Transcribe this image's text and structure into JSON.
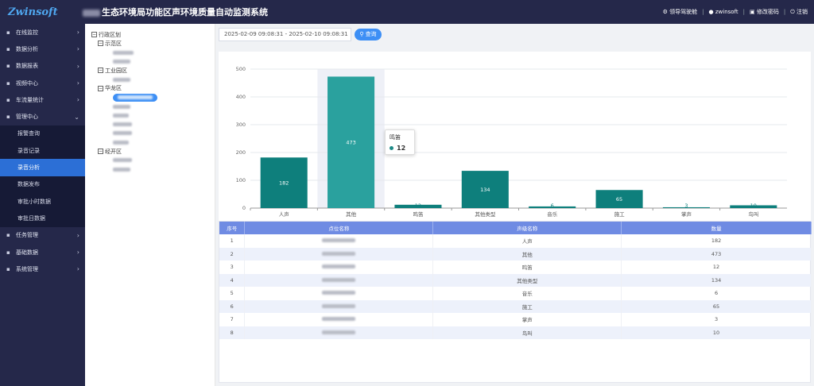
{
  "header": {
    "logo_text": "Zwinsoft",
    "title": "生态环境局功能区声环境质量自动监测系统",
    "right": {
      "nav_label": "领导驾驶舱",
      "user_label": "zwinsoft",
      "password_label": "修改密码",
      "logout_label": "注销"
    }
  },
  "sidebar": {
    "items": [
      {
        "label": "在线监控",
        "icon": "monitor-icon"
      },
      {
        "label": "数据分析",
        "icon": "chart-icon"
      },
      {
        "label": "数据报表",
        "icon": "report-icon"
      },
      {
        "label": "视频中心",
        "icon": "video-icon"
      },
      {
        "label": "车流量统计",
        "icon": "car-icon"
      },
      {
        "label": "管理中心",
        "icon": "manage-icon",
        "expanded": true
      }
    ],
    "subitems": [
      {
        "label": "报警查询"
      },
      {
        "label": "录音记录"
      },
      {
        "label": "录音分析",
        "active": true
      },
      {
        "label": "数据发布"
      },
      {
        "label": "审批小时数据"
      },
      {
        "label": "审批日数据"
      }
    ],
    "items_after": [
      {
        "label": "任务管理",
        "icon": "task-icon"
      },
      {
        "label": "基础数据",
        "icon": "data-icon"
      },
      {
        "label": "系统管理",
        "icon": "gear-icon"
      }
    ]
  },
  "tree": {
    "root": "行政区划",
    "groups": [
      {
        "label": "示范区",
        "leaves": 2
      },
      {
        "label": "工业园区",
        "leaves": 1
      },
      {
        "label": "华龙区",
        "leaves": 6
      },
      {
        "label": "经开区",
        "leaves": 2
      }
    ]
  },
  "toolbar": {
    "date_range": "2025-02-09 09:08:31 - 2025-02-10 09:08:31",
    "query_label": "查询"
  },
  "chart_data": {
    "type": "bar",
    "categories": [
      "人声",
      "其他",
      "鸣笛",
      "其他类型",
      "音乐",
      "施工",
      "掌声",
      "鸟叫"
    ],
    "values": [
      182,
      473,
      12,
      134,
      6,
      65,
      3,
      10
    ],
    "ylim": [
      0,
      500
    ],
    "yticks": [
      0,
      100,
      200,
      300,
      400,
      500
    ],
    "grid": true,
    "highlight_index": 1,
    "colors": {
      "bar": "#0e7f7c",
      "bar_highlight": "#2aa19e",
      "highlight_bg": "#eef0f7"
    }
  },
  "tooltip": {
    "title": "鸣笛",
    "value": "12"
  },
  "table": {
    "headers": [
      "序号",
      "点位名称",
      "声级名称",
      "数量"
    ],
    "rows": [
      {
        "no": "1",
        "type": "人声",
        "count": "182"
      },
      {
        "no": "2",
        "type": "其他",
        "count": "473"
      },
      {
        "no": "3",
        "type": "鸣笛",
        "count": "12"
      },
      {
        "no": "4",
        "type": "其他类型",
        "count": "134"
      },
      {
        "no": "5",
        "type": "音乐",
        "count": "6"
      },
      {
        "no": "6",
        "type": "施工",
        "count": "65"
      },
      {
        "no": "7",
        "type": "掌声",
        "count": "3"
      },
      {
        "no": "8",
        "type": "鸟叫",
        "count": "10"
      }
    ]
  }
}
